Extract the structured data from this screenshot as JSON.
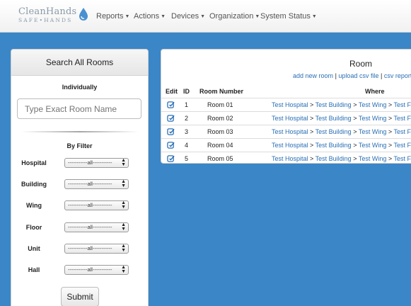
{
  "brand": {
    "main": "CleanHands",
    "sub": "SAFE•HANDS"
  },
  "nav": [
    {
      "label": "Reports"
    },
    {
      "label": "Actions"
    },
    {
      "label": "Devices"
    },
    {
      "label": "Organization"
    },
    {
      "label": "System Status"
    }
  ],
  "search_panel": {
    "title": "Search All Rooms",
    "individually_label": "Individually",
    "room_input_placeholder": "Type Exact Room Name",
    "by_filter_label": "By Filter",
    "filters": [
      {
        "label": "Hospital",
        "value": "-----------all-----------"
      },
      {
        "label": "Building",
        "value": "-----------all-----------"
      },
      {
        "label": "Wing",
        "value": "-----------all-----------"
      },
      {
        "label": "Floor",
        "value": "-----------all-----------"
      },
      {
        "label": "Unit",
        "value": "-----------all-----------"
      },
      {
        "label": "Hall",
        "value": "-----------all-----------"
      }
    ],
    "submit_label": "Submit"
  },
  "room_panel": {
    "title": "Room",
    "links": {
      "add": "add new room",
      "upload": "upload csv file",
      "report": "csv report",
      "sep": "|",
      "trail": "c"
    },
    "columns": {
      "edit": "Edit",
      "id": "ID",
      "room_number": "Room Number",
      "where": "Where"
    },
    "rows": [
      {
        "id": "1",
        "room": "Room 01",
        "hospital": "Test Hospital",
        "building": "Test Building",
        "wing": "Test Wing",
        "floor": "Test Flo"
      },
      {
        "id": "2",
        "room": "Room 02",
        "hospital": "Test Hospital",
        "building": "Test Building",
        "wing": "Test Wing",
        "floor": "Test Flo"
      },
      {
        "id": "3",
        "room": "Room 03",
        "hospital": "Test Hospital",
        "building": "Test Building",
        "wing": "Test Wing",
        "floor": "Test Flo"
      },
      {
        "id": "4",
        "room": "Room 04",
        "hospital": "Test Hospital",
        "building": "Test Building",
        "wing": "Test Wing",
        "floor": "Test Flo"
      },
      {
        "id": "5",
        "room": "Room 05",
        "hospital": "Test Hospital",
        "building": "Test Building",
        "wing": "Test Wing",
        "floor": "Test Flo"
      }
    ],
    "where_sep": ">"
  },
  "colors": {
    "background": "#3a86c7",
    "link": "#2a6fb5",
    "brand_text": "#8a9aa8",
    "brand_drop": "#4a90d0"
  },
  "icons": {
    "edit": "edit-square-icon",
    "brand": "water-drop-icon"
  }
}
